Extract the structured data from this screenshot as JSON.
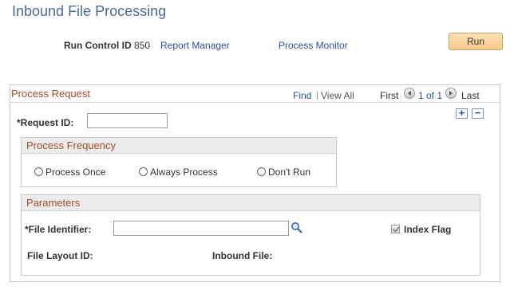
{
  "page": {
    "title": "Inbound File Processing"
  },
  "run_control": {
    "label": "Run Control ID",
    "value": "850",
    "report_manager_link": "Report Manager",
    "process_monitor_link": "Process Monitor",
    "run_button": "Run"
  },
  "process_request": {
    "title": "Process Request",
    "find_link": "Find",
    "separator": "|",
    "view_all_link": "View All",
    "first_link": "First",
    "record_position": "1 of 1",
    "last_link": "Last",
    "add_row_symbol": "+",
    "delete_row_symbol": "−",
    "request_id_label": "*Request ID:",
    "request_id_value": ""
  },
  "process_frequency": {
    "title": "Process Frequency",
    "options": [
      "Process Once",
      "Always Process",
      "Don't Run"
    ]
  },
  "parameters": {
    "title": "Parameters",
    "file_identifier_label": "*File Identifier:",
    "file_identifier_value": "",
    "index_flag_label": "Index Flag",
    "file_layout_id_label": "File Layout ID:",
    "inbound_file_label": "Inbound File:"
  },
  "icons": {
    "lookup": "magnifier-icon",
    "previous": "previous-arrow-icon",
    "next": "next-arrow-icon"
  },
  "colors": {
    "title": "#4a6b9a",
    "link": "#2a4f9a",
    "section_title": "#a44a2a",
    "run_button": "#f6c98a"
  }
}
